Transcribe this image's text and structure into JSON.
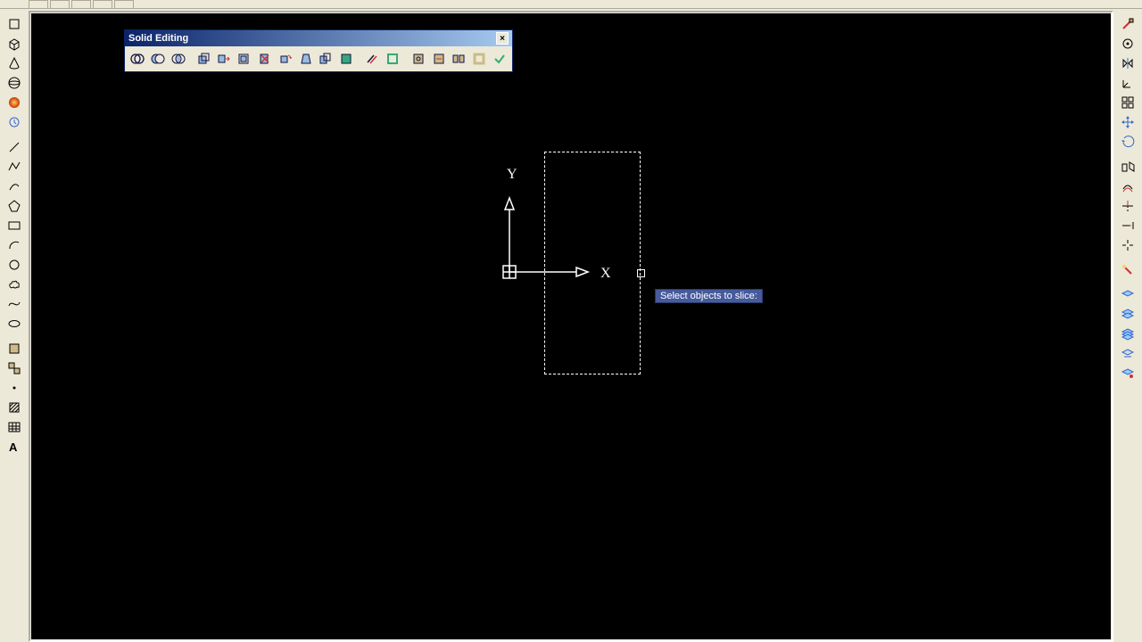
{
  "floating_toolbar": {
    "title": "Solid Editing",
    "close_symbol": "×"
  },
  "prompt": {
    "text": "Select objects to slice:"
  },
  "ucs": {
    "x_label": "X",
    "y_label": "Y"
  },
  "icons": {
    "left": [
      "box-icon",
      "cube-icon",
      "cone-icon",
      "sphere-icon",
      "gradient-sphere-icon",
      "history-icon",
      "sep",
      "line-icon",
      "polyline-icon",
      "arc-line-icon",
      "polygon-icon",
      "rectangle-icon",
      "arc-icon",
      "circle-icon",
      "cloud-icon",
      "spline-icon",
      "ellipse-icon",
      "sep",
      "block-icon",
      "region-icon",
      "point-icon",
      "hatch-icon",
      "table-icon",
      "mtext-icon"
    ],
    "right": [
      "material-icon",
      "osnap-icon",
      "mirror3d-icon",
      "ucs3d-icon",
      "grid-icon",
      "move3d-icon",
      "rotate3d-icon",
      "sep",
      "align-icon",
      "offset-icon",
      "trim-icon",
      "extend-icon",
      "break-icon",
      "sep",
      "layer-icon",
      "layerstate1-icon",
      "layerstate2-icon",
      "layerstate3-icon",
      "freeze-icon",
      "explode-icon"
    ],
    "floating": [
      "union-icon",
      "subtract-icon",
      "intersect-icon",
      "sep",
      "extrude-face-icon",
      "move-face-icon",
      "offset-face-icon",
      "delete-face-icon",
      "rotate-face-icon",
      "taper-face-icon",
      "copy-face-icon",
      "color-face-icon",
      "sep",
      "copy-edge-icon",
      "color-edge-icon",
      "sep",
      "imprint-icon",
      "clean-icon",
      "separate-icon",
      "shell-icon",
      "check-icon"
    ]
  }
}
